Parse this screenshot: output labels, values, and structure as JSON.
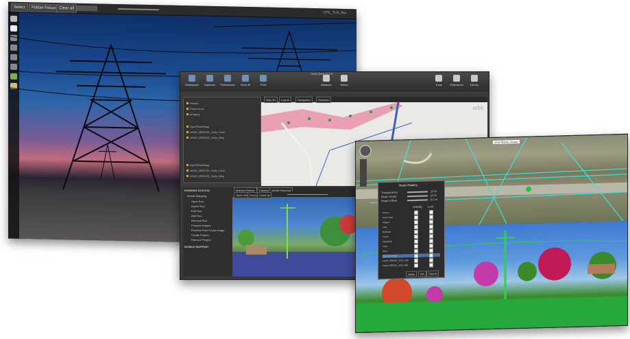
{
  "photo_window": {
    "toolbar": {
      "select": "Select",
      "follow_focus": "Follow Focus",
      "clear_all": "Clear all"
    },
    "title": "UTIL_TLN_ALL"
  },
  "gis_window": {
    "title": "Orbit Client 11.2.5",
    "ribbon": [
      "Workspace",
      "Inspector",
      "Preferences",
      "Save all",
      "Print"
    ],
    "ribbon_right": [
      "Measure",
      "Select",
      "Tools",
      "Extensions",
      "Library"
    ],
    "layers": [
      "Photos",
      "Point cloud",
      "Imagery",
      "OpenStreetMap",
      "10001_BRIDGE_Soltz_Lidar",
      "10002_BRIDGE_Soltz_Map",
      "OpenStreetMap",
      "10001_BRIDGE_Soltz_Lidar",
      "10002_BRIDGE_Soltz_Map"
    ],
    "map_tabs": [
      "Map 2D",
      "Layout",
      "Navigation",
      "Selection"
    ],
    "map_logo": "orbit",
    "view_tabs": [
      "Mapbox/Viewer",
      "Catalog",
      "Mobile Mapping"
    ],
    "view_toolbar": [
      "Open View",
      "Focus",
      "Close all"
    ],
    "tree": {
      "section1": "RUNNING STATION",
      "node": "Mobile Mapping",
      "items": [
        "Open Run",
        "Import Run",
        "Edit Run",
        "Add Run",
        "Remove Run",
        "Process Images",
        "Process Point Cloud Image",
        "Create Project",
        "Remove Project"
      ],
      "section2": "MOBILE MAPPING"
    }
  },
  "front_window": {
    "map_label": "Orbit Mobile Viewer",
    "dialog": {
      "title": "Model Shading",
      "sliders": [
        {
          "label": "Transparency",
          "value": "10 %"
        },
        {
          "label": "Water Depth",
          "value": "20 %"
        },
        {
          "label": "Height Offset",
          "value": "0.0 m"
        }
      ],
      "columns": [
        "Visibility",
        "Lock"
      ],
      "rows": [
        "Photos",
        "Point cloud",
        "Imagery",
        "Lidar",
        "Buildings",
        "Terrain",
        "Vegetation",
        "Poles",
        "Wires",
        "OpenStreetMap",
        "10001_BRIDGE_Soltz_Lidar",
        "10002_BRIDGE_Soltz_Map"
      ],
      "buttons": [
        "Apply",
        "OK",
        "Cancel"
      ]
    }
  }
}
